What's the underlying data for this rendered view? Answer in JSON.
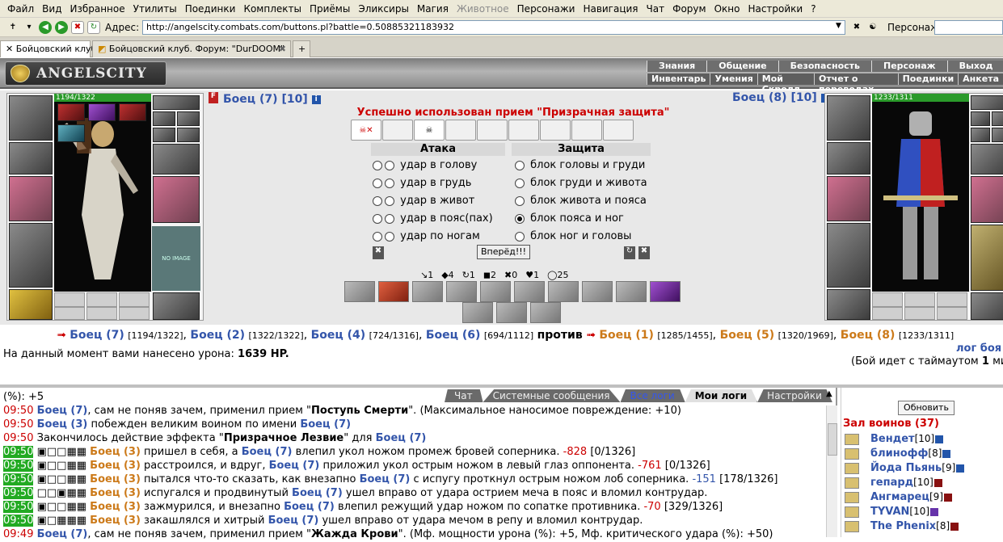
{
  "menu": [
    "Файл",
    "Вид",
    "Избранное",
    "Утилиты",
    "Поединки",
    "Комплекты",
    "Приёмы",
    "Эликсиры",
    "Магия",
    "Животное",
    "Персонажи",
    "Навигация",
    "Чат",
    "Форум",
    "Окно",
    "Настройки",
    "?"
  ],
  "addr": {
    "label": "Адрес:",
    "url": "http://angelscity.combats.com/buttons.pl?battle=0.50885321183932",
    "persona_label": "Персонаж:"
  },
  "tabs": [
    "Бойцовский клуб",
    "Бойцовский клуб. Форум: \"DurDOOM\""
  ],
  "game": {
    "logo": "ANGELSCITY",
    "nav_top": [
      "Знания",
      "Общение",
      "Безопасность",
      "Персонаж",
      "Выход"
    ],
    "nav_sub": [
      "Инвентарь",
      "Умения",
      "Мой Скролл",
      "Отчет о переводах",
      "Поединки",
      "Анкета"
    ]
  },
  "left_fighter": {
    "name": "Боец (7) [10]",
    "hp": "1194/1322",
    "noimg": "NO IMAGE"
  },
  "right_fighter": {
    "name": "Боец (8) [10]",
    "hp": "1233/1311"
  },
  "status_msg": "Успешно использован прием \"Призрачная защита\"",
  "attack": {
    "title": "Атака",
    "rows": [
      "удар в голову",
      "удар в грудь",
      "удар в живот",
      "удар в пояс(пах)",
      "удар по ногам"
    ]
  },
  "defense": {
    "title": "Защита",
    "rows": [
      "блок головы и груди",
      "блок груди и живота",
      "блок живота и пояса",
      "блок пояса и ног",
      "блок ног и головы"
    ],
    "selected": 3
  },
  "go_btn": "Вперёд!!!",
  "stats": [
    "↘1",
    "◆4",
    "↻1",
    "◼2",
    "✖0",
    "♥1",
    "◯25"
  ],
  "matchup": {
    "left": [
      {
        "n": "Боец (7)",
        "hp": "[1194/1322]"
      },
      {
        "n": "Боец (2)",
        "hp": "[1322/1322]"
      },
      {
        "n": "Боец (4)",
        "hp": "[724/1316]"
      },
      {
        "n": "Боец (6)",
        "hp": "[694/1112]"
      }
    ],
    "vs": "против",
    "right": [
      {
        "n": "Боец (1)",
        "hp": "[1285/1455]"
      },
      {
        "n": "Боец (5)",
        "hp": "[1320/1969]"
      },
      {
        "n": "Боец (8)",
        "hp": "[1233/1311]"
      }
    ]
  },
  "damage": {
    "text": "На данный момент вами нанесено урона:",
    "val": "1639 HP."
  },
  "log_link": "лог боя",
  "timeout": {
    "a": "(Бой идет с таймаутом",
    "b": "1",
    "c": "ми"
  },
  "chat_tabs": [
    "Чат",
    "Системные сообщения",
    "Все логи",
    "Мои логи",
    "Настройки"
  ],
  "log": [
    {
      "t": "",
      "parts": [
        {
          "x": "(%): +5",
          "c": ""
        }
      ]
    },
    {
      "t": "09:50",
      "g": false,
      "parts": [
        {
          "x": "Боец (7)",
          "c": "blu"
        },
        {
          "x": ", сам не поняв зачем, применил прием \"",
          "c": ""
        },
        {
          "x": "Поступь Смерти",
          "c": "b"
        },
        {
          "x": "\". (Максимальное наносимое повреждение: +10)",
          "c": ""
        }
      ]
    },
    {
      "t": "09:50",
      "g": false,
      "parts": [
        {
          "x": "Боец (3)",
          "c": "blu"
        },
        {
          "x": " побежден великим воином по имени ",
          "c": ""
        },
        {
          "x": "Боец (7)",
          "c": "blu"
        }
      ]
    },
    {
      "t": "09:50",
      "g": false,
      "parts": [
        {
          "x": "Закончилось действие эффекта \"",
          "c": ""
        },
        {
          "x": "Призрачное Лезвие",
          "c": "b"
        },
        {
          "x": "\" для ",
          "c": ""
        },
        {
          "x": "Боец (7)",
          "c": "blu"
        }
      ]
    },
    {
      "t": "09:50",
      "g": true,
      "parts": [
        {
          "x": "▣□□▦▦ ",
          "c": ""
        },
        {
          "x": "Боец (3)",
          "c": "br"
        },
        {
          "x": " пришел в себя, а ",
          "c": ""
        },
        {
          "x": "Боец (7)",
          "c": "blu"
        },
        {
          "x": " влепил укол ножом промеж бровей соперника. ",
          "c": ""
        },
        {
          "x": "-828",
          "c": "red"
        },
        {
          "x": " [0/1326]",
          "c": ""
        }
      ]
    },
    {
      "t": "09:50",
      "g": true,
      "parts": [
        {
          "x": "▣□□▦▦ ",
          "c": ""
        },
        {
          "x": "Боец (3)",
          "c": "br"
        },
        {
          "x": " расстроился, и вдруг, ",
          "c": ""
        },
        {
          "x": "Боец (7)",
          "c": "blu"
        },
        {
          "x": " приложил укол острым ножом в левый глаз оппонента. ",
          "c": ""
        },
        {
          "x": "-761",
          "c": "red"
        },
        {
          "x": " [0/1326]",
          "c": ""
        }
      ]
    },
    {
      "t": "09:50",
      "g": true,
      "parts": [
        {
          "x": "▣□□▦▦ ",
          "c": ""
        },
        {
          "x": "Боец (3)",
          "c": "br"
        },
        {
          "x": " пытался что-то сказать, как внезапно ",
          "c": ""
        },
        {
          "x": "Боец (7)",
          "c": "blu"
        },
        {
          "x": " с испугу проткнул острым ножом лоб соперника. ",
          "c": ""
        },
        {
          "x": "-151",
          "c": "blu"
        },
        {
          "x": " [178/1326]",
          "c": ""
        }
      ]
    },
    {
      "t": "09:50",
      "g": true,
      "parts": [
        {
          "x": "□□▣▦▦ ",
          "c": ""
        },
        {
          "x": "Боец (3)",
          "c": "br"
        },
        {
          "x": " испугался и продвинутый ",
          "c": ""
        },
        {
          "x": "Боец (7)",
          "c": "blu"
        },
        {
          "x": " ушел вправо от удара острием меча в пояс и вломил контрудар.",
          "c": ""
        }
      ]
    },
    {
      "t": "09:50",
      "g": true,
      "parts": [
        {
          "x": "▣□□▦▦ ",
          "c": ""
        },
        {
          "x": "Боец (3)",
          "c": "br"
        },
        {
          "x": " зажмурился, и внезапно ",
          "c": ""
        },
        {
          "x": "Боец (7)",
          "c": "blu"
        },
        {
          "x": " влепил режущий удар ножом по сопатке противника. ",
          "c": ""
        },
        {
          "x": "-70",
          "c": "red"
        },
        {
          "x": " [329/1326]",
          "c": ""
        }
      ]
    },
    {
      "t": "09:50",
      "g": true,
      "parts": [
        {
          "x": "▣□▦▦▦ ",
          "c": ""
        },
        {
          "x": "Боец (3)",
          "c": "br"
        },
        {
          "x": " закашлялся и хитрый ",
          "c": ""
        },
        {
          "x": "Боец (7)",
          "c": "blu"
        },
        {
          "x": " ушел вправо от удара мечом в репу и вломил контрудар.",
          "c": ""
        }
      ]
    },
    {
      "t": "09:49",
      "g": false,
      "parts": [
        {
          "x": "Боец (7)",
          "c": "blu"
        },
        {
          "x": ", сам не поняв зачем, применил прием \"",
          "c": ""
        },
        {
          "x": "Жажда Крови",
          "c": "b"
        },
        {
          "x": "\". (Мф. мощности урона (%): +5, Мф. критического удара (%): +50)",
          "c": ""
        }
      ]
    }
  ],
  "sidebar": {
    "refresh": "Обновить",
    "hall": "Зал воинов (37)",
    "warriors": [
      {
        "n": "Вендет",
        "l": "[10]",
        "i": [
          "b"
        ]
      },
      {
        "n": "блинофф",
        "l": "[8]",
        "i": [
          "b"
        ]
      },
      {
        "n": "Йода Пьянь",
        "l": "[9]",
        "i": [
          "b"
        ]
      },
      {
        "n": "гепард",
        "l": "[10]",
        "i": [
          "r"
        ]
      },
      {
        "n": "Ангмарец",
        "l": "[9]",
        "i": [
          "r"
        ]
      },
      {
        "n": "TYVAN",
        "l": "[10]",
        "i": [
          "p"
        ]
      },
      {
        "n": "The Phenix",
        "l": "[8]",
        "i": [
          "r"
        ]
      }
    ]
  }
}
